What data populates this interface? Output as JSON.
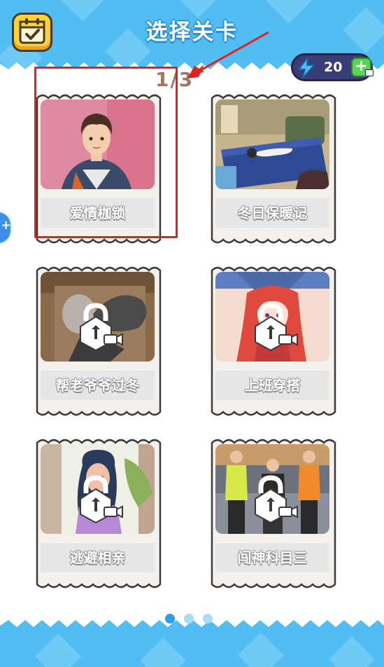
{
  "header": {
    "title": "选择关卡",
    "calendar_icon": "calendar-check-icon",
    "energy": {
      "value": "20",
      "icon": "lightning-icon",
      "add_icon": "plus-icon",
      "video_icon": "video-icon"
    }
  },
  "page_counter": "1/3",
  "side_button": {
    "icon": "plus-icon"
  },
  "levels": [
    {
      "name": "爱情枷锁",
      "locked": false
    },
    {
      "name": "冬日保暖记",
      "locked": false
    },
    {
      "name": "帮老爷爷过冬",
      "locked": true,
      "lock_icon": "lock-video-icon"
    },
    {
      "name": "上班穿搭",
      "locked": true,
      "lock_icon": "lock-video-icon"
    },
    {
      "name": "逃避相亲",
      "locked": true,
      "lock_icon": "lock-video-icon"
    },
    {
      "name": "闯神科目三",
      "locked": true,
      "lock_icon": "lock-video-icon"
    }
  ],
  "pagination": {
    "pages": 3,
    "active": 1
  },
  "colors": {
    "header_blue": "#52bdf2",
    "accent_yellow": "#fcd13a",
    "annotation_red": "#e0231d",
    "dot_active": "#2e9ee8",
    "dot_inactive": "#a8dcf7"
  }
}
